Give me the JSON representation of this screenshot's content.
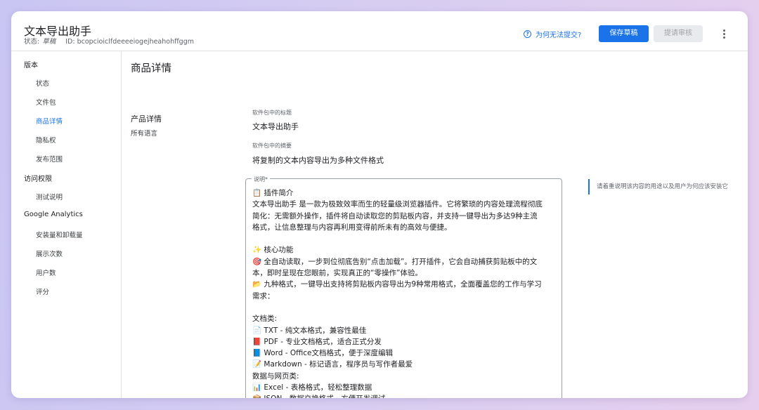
{
  "header": {
    "title": "文本导出助手",
    "status_label": "状态:",
    "status_value": "草稿",
    "id_label": "ID:",
    "id_value": "bcopcioiclfdeeeeiogejheahohffggm",
    "help_link": "为何无法提交?",
    "save_button": "保存草稿",
    "submit_button": "提请审核",
    "more_icon": "more-vert-icon",
    "help_icon": "help-circle-icon"
  },
  "sidebar": {
    "sections": [
      {
        "title": "版本",
        "items": [
          {
            "label": "状态",
            "active": false
          },
          {
            "label": "文件包",
            "active": false
          },
          {
            "label": "商品详情",
            "active": true
          },
          {
            "label": "隐私权",
            "active": false
          },
          {
            "label": "发布范围",
            "active": false
          }
        ]
      },
      {
        "title": "访问权限",
        "items": [
          {
            "label": "测试说明",
            "active": false
          }
        ]
      },
      {
        "title": "Google Analytics",
        "items": [
          {
            "label": "安装量和卸载量",
            "active": false
          },
          {
            "label": "展示次数",
            "active": false
          },
          {
            "label": "用户数",
            "active": false
          },
          {
            "label": "评分",
            "active": false
          }
        ]
      }
    ]
  },
  "main": {
    "page_title": "商品详情",
    "section_title": "产品详情",
    "section_subtitle": "所有语言",
    "fields": {
      "title_label": "软件包中的标题",
      "title_value": "文本导出助手",
      "summary_label": "软件包中的摘要",
      "summary_value": "将复制的文本内容导出为多种文件格式",
      "description_label": "说明*",
      "description_hint": "请着重说明该内容的用途以及用户为何应该安装它",
      "description_lines": [
        "📋 插件简介",
        "文本导出助手 是一款为极致效率而生的轻量级浏览器插件。它将繁琐的内容处理流程彻底",
        "简化：无需额外操作，插件将自动读取您的剪贴板内容，并支持一键导出为多达9种主流",
        "格式，让信息整理与内容再利用变得前所未有的高效与便捷。",
        "",
        "✨ 核心功能",
        "🎯 全自动读取，一步到位彻底告别“点击加载”。打开插件，它会自动捕获剪贴板中的文",
        "本，即时呈现在您眼前，实现真正的“零操作”体验。",
        "📂 九种格式，一键导出支持将剪贴板内容导出为9种常用格式，全面覆盖您的工作与学习",
        "需求：",
        "",
        "文档类:",
        "📄 TXT - 纯文本格式，兼容性最佳",
        "📕 PDF - 专业文档格式，适合正式分发",
        "📘 Word - Office文档格式，便于深度编辑",
        "📝 Markdown - 标记语言，程序员与写作者最爱",
        "数据与网页类:",
        "📊 Excel - 表格格式，轻松整理数据",
        "📦 JSON - 数据交换格式，方便开发调试"
      ]
    }
  },
  "colors": {
    "accent": "#1a73e8",
    "disabled_bg": "#e8eaed",
    "divider": "#e0e0e0"
  }
}
